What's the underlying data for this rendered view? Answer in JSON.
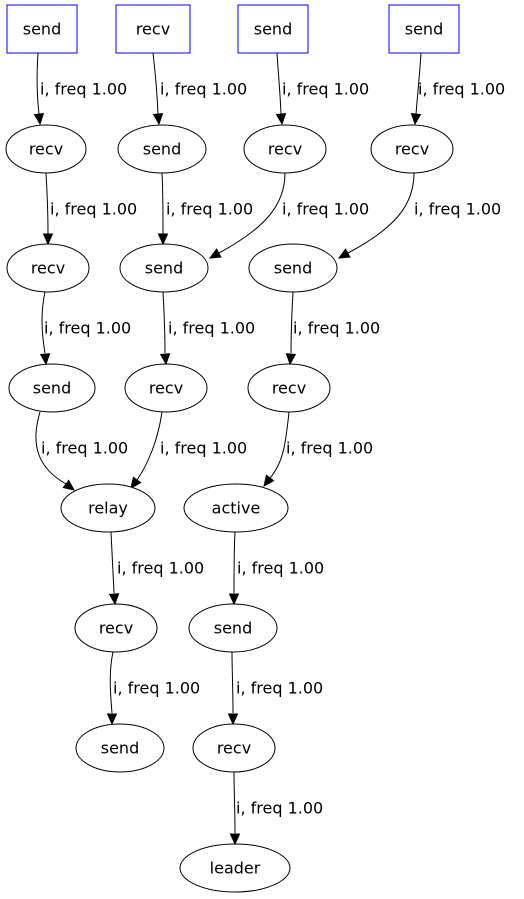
{
  "graph": {
    "box_color": "#0000ff",
    "nodes": [
      {
        "id": "s1",
        "label": "send",
        "shape": "box"
      },
      {
        "id": "s2",
        "label": "recv",
        "shape": "box"
      },
      {
        "id": "s3",
        "label": "send",
        "shape": "box"
      },
      {
        "id": "s4",
        "label": "send",
        "shape": "box"
      },
      {
        "id": "a1",
        "label": "recv",
        "shape": "ellipse"
      },
      {
        "id": "a2",
        "label": "send",
        "shape": "ellipse"
      },
      {
        "id": "a3",
        "label": "recv",
        "shape": "ellipse"
      },
      {
        "id": "a4",
        "label": "recv",
        "shape": "ellipse"
      },
      {
        "id": "b1",
        "label": "recv",
        "shape": "ellipse"
      },
      {
        "id": "b2",
        "label": "send",
        "shape": "ellipse"
      },
      {
        "id": "b3",
        "label": "send",
        "shape": "ellipse"
      },
      {
        "id": "c1",
        "label": "send",
        "shape": "ellipse"
      },
      {
        "id": "c2",
        "label": "recv",
        "shape": "ellipse"
      },
      {
        "id": "c3",
        "label": "recv",
        "shape": "ellipse"
      },
      {
        "id": "d1",
        "label": "relay",
        "shape": "ellipse"
      },
      {
        "id": "d2",
        "label": "active",
        "shape": "ellipse"
      },
      {
        "id": "e1",
        "label": "recv",
        "shape": "ellipse"
      },
      {
        "id": "e2",
        "label": "send",
        "shape": "ellipse"
      },
      {
        "id": "f1",
        "label": "send",
        "shape": "ellipse"
      },
      {
        "id": "f2",
        "label": "recv",
        "shape": "ellipse"
      },
      {
        "id": "g1",
        "label": "leader",
        "shape": "ellipse"
      }
    ],
    "edges": [
      {
        "from": "s1",
        "to": "a1",
        "label": "i, freq 1.00"
      },
      {
        "from": "s2",
        "to": "a2",
        "label": "i, freq 1.00"
      },
      {
        "from": "s3",
        "to": "a3",
        "label": "i, freq 1.00"
      },
      {
        "from": "s4",
        "to": "a4",
        "label": "i, freq 1.00"
      },
      {
        "from": "a1",
        "to": "b1",
        "label": "i, freq 1.00"
      },
      {
        "from": "a2",
        "to": "b2",
        "label": "i, freq 1.00"
      },
      {
        "from": "a3",
        "to": "b2",
        "label": "i, freq 1.00"
      },
      {
        "from": "a4",
        "to": "b3",
        "label": "i, freq 1.00"
      },
      {
        "from": "b1",
        "to": "c1",
        "label": "i, freq 1.00"
      },
      {
        "from": "b2",
        "to": "c2",
        "label": "i, freq 1.00"
      },
      {
        "from": "b3",
        "to": "c3",
        "label": "i, freq 1.00"
      },
      {
        "from": "c1",
        "to": "d1",
        "label": "i, freq 1.00"
      },
      {
        "from": "c2",
        "to": "d1",
        "label": "i, freq 1.00"
      },
      {
        "from": "c3",
        "to": "d2",
        "label": "i, freq 1.00"
      },
      {
        "from": "d1",
        "to": "e1",
        "label": "i, freq 1.00"
      },
      {
        "from": "d2",
        "to": "e2",
        "label": "i, freq 1.00"
      },
      {
        "from": "e1",
        "to": "f1",
        "label": "i, freq 1.00"
      },
      {
        "from": "e2",
        "to": "f2",
        "label": "i, freq 1.00"
      },
      {
        "from": "f2",
        "to": "g1",
        "label": "i, freq 1.00"
      }
    ]
  }
}
